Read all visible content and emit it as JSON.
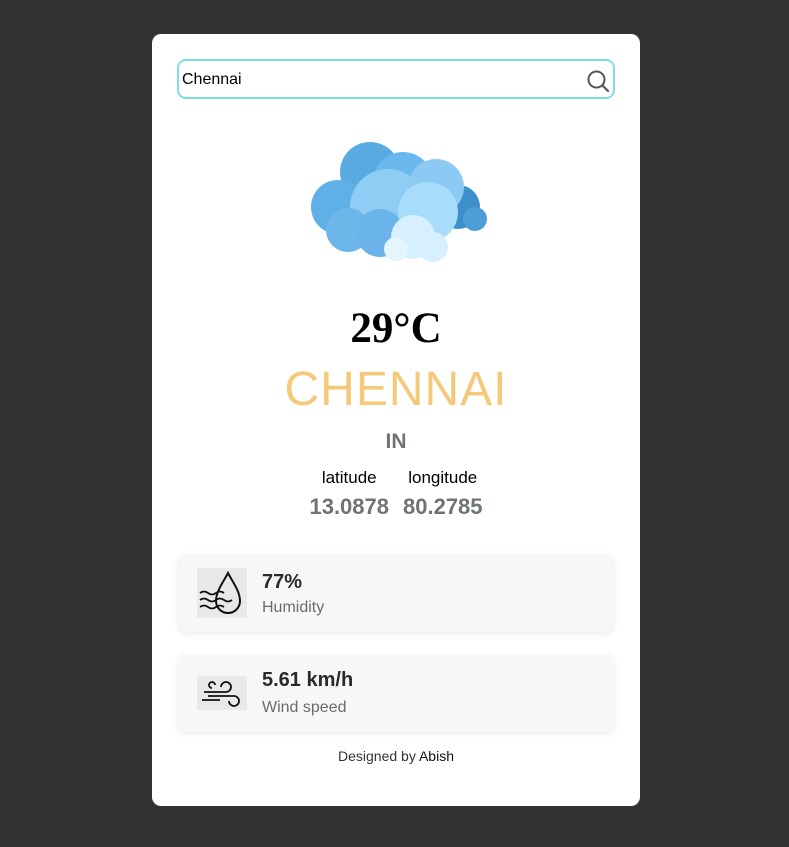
{
  "search": {
    "value": "Chennai",
    "placeholder": ""
  },
  "weather": {
    "temperature": "29°C",
    "city": "CHENNAI",
    "country": "IN",
    "latitude_label": "latitude",
    "longitude_label": "longitude",
    "latitude": "13.0878",
    "longitude": "80.2785",
    "icon": "cloud-icon"
  },
  "humidity": {
    "value": "77%",
    "label": "Humidity",
    "icon": "humidity-icon"
  },
  "wind": {
    "value": "5.61 km/h",
    "label": "Wind speed",
    "icon": "wind-icon"
  },
  "footer": {
    "prefix": "Designed by",
    "author": "Abish"
  },
  "colors": {
    "background": "#323130",
    "card": "#ffffff",
    "search_border": "#7fdde6",
    "city": "#f5c97a",
    "muted": "#6f7376"
  }
}
